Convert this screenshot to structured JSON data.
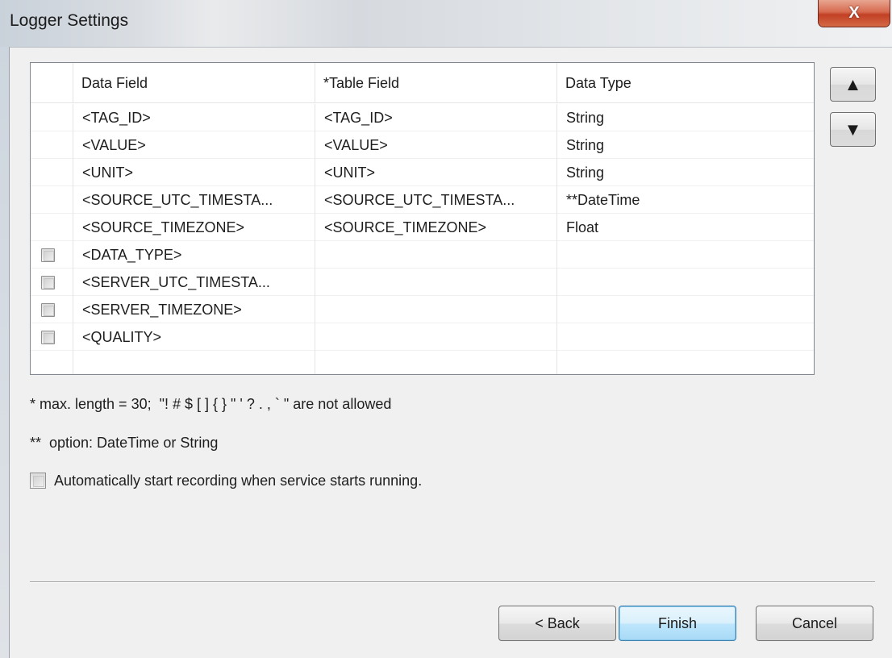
{
  "window": {
    "title": "Logger Settings",
    "close_label": "X"
  },
  "grid": {
    "headers": [
      "",
      "Data Field",
      "*Table Field",
      "Data Type"
    ],
    "rows": [
      {
        "checkbox": false,
        "data_field": "<TAG_ID>",
        "table_field": "<TAG_ID>",
        "data_type": "String"
      },
      {
        "checkbox": false,
        "data_field": "<VALUE>",
        "table_field": "<VALUE>",
        "data_type": "String"
      },
      {
        "checkbox": false,
        "data_field": "<UNIT>",
        "table_field": "<UNIT>",
        "data_type": "String"
      },
      {
        "checkbox": false,
        "data_field": "<SOURCE_UTC_TIMESTA...",
        "table_field": "<SOURCE_UTC_TIMESTA...",
        "data_type": "**DateTime"
      },
      {
        "checkbox": false,
        "data_field": "<SOURCE_TIMEZONE>",
        "table_field": "<SOURCE_TIMEZONE>",
        "data_type": "Float"
      },
      {
        "checkbox": true,
        "data_field": "<DATA_TYPE>",
        "table_field": "",
        "data_type": ""
      },
      {
        "checkbox": true,
        "data_field": "<SERVER_UTC_TIMESTA...",
        "table_field": "",
        "data_type": ""
      },
      {
        "checkbox": true,
        "data_field": "<SERVER_TIMEZONE>",
        "table_field": "",
        "data_type": ""
      },
      {
        "checkbox": true,
        "data_field": "<QUALITY>",
        "table_field": "",
        "data_type": ""
      }
    ]
  },
  "move_buttons": {
    "up_icon": "triangle-up-icon",
    "up_glyph": "▲",
    "down_icon": "triangle-down-icon",
    "down_glyph": "▼"
  },
  "notes": {
    "max_length": "* max. length = 30;  \"! # $ [ ] { } \" ' ? . , ` \" are not allowed",
    "option": "**  option: DateTime or String"
  },
  "auto_start": {
    "label": "Automatically start recording when service starts running.",
    "checked": false
  },
  "footer": {
    "back_label": "< Back",
    "finish_label": "Finish",
    "cancel_label": "Cancel"
  }
}
